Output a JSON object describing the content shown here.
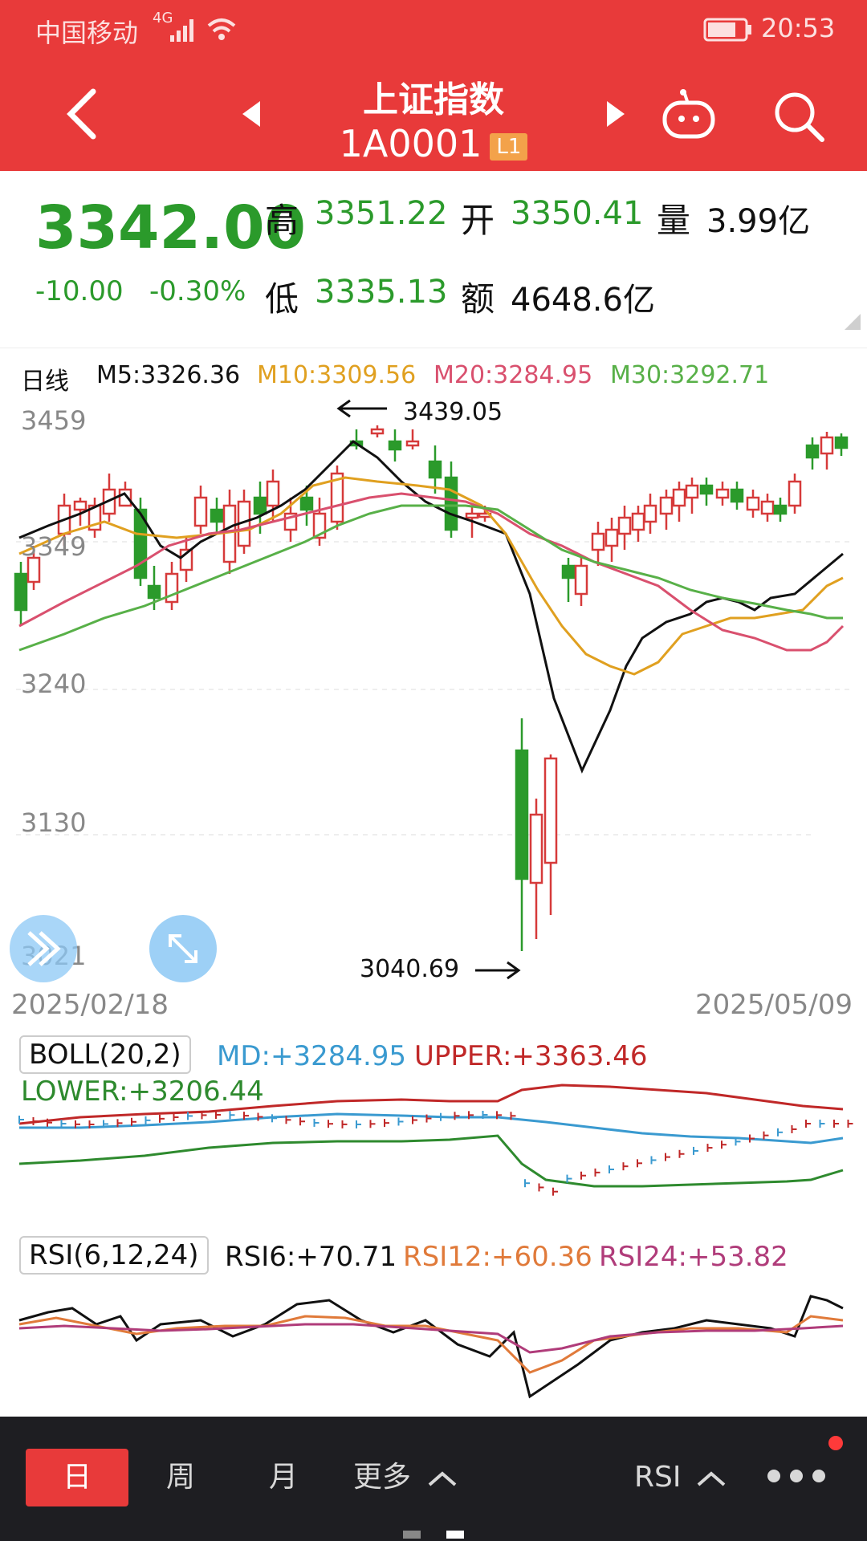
{
  "status_bar": {
    "carrier": "中国移动",
    "network": "4G",
    "time": "20:53"
  },
  "header": {
    "title": "上证指数",
    "code": "1A0001",
    "level_badge": "L1"
  },
  "quote": {
    "price": "3342.00",
    "change": "-10.00",
    "change_pct": "-0.30%",
    "high_label": "高",
    "high": "3351.22",
    "open_label": "开",
    "open": "3350.41",
    "volume_label": "量",
    "volume": "3.99亿",
    "low_label": "低",
    "low": "3335.13",
    "amount_label": "额",
    "amount": "4648.6亿"
  },
  "ma_legend": {
    "period": "日线",
    "m5": "M5:3326.36",
    "m10": "M10:3309.56",
    "m20": "M20:3284.95",
    "m30": "M30:3292.71"
  },
  "kline": {
    "y_ticks": [
      "3459",
      "3349",
      "3240",
      "3130",
      "3021"
    ],
    "annotation_high": "3439.05",
    "annotation_low": "3040.69",
    "date_start": "2025/02/18",
    "date_end": "2025/05/09"
  },
  "boll": {
    "label": "BOLL(20,2)",
    "md": "MD:+3284.95",
    "upper": "UPPER:+3363.46",
    "lower": "LOWER:+3206.44"
  },
  "rsi": {
    "label": "RSI(6,12,24)",
    "rsi6": "RSI6:+70.71",
    "rsi12": "RSI12:+60.36",
    "rsi24": "RSI24:+53.82"
  },
  "bottom_bar": {
    "tabs": [
      "日",
      "周",
      "月",
      "更多"
    ],
    "indicator": "RSI"
  },
  "colors": {
    "header_red": "#e83a3a",
    "down_green": "#2b9a2b",
    "up_red": "#d63a3a",
    "m5": "#111111",
    "m10": "#e0a020",
    "m20": "#d9506e",
    "m30": "#58b048",
    "md": "#3a9ad0",
    "upper": "#c02828",
    "lower": "#2e8a2e",
    "rsi6": "#111111",
    "rsi12": "#e07a3a",
    "rsi24": "#b03c7a"
  }
}
